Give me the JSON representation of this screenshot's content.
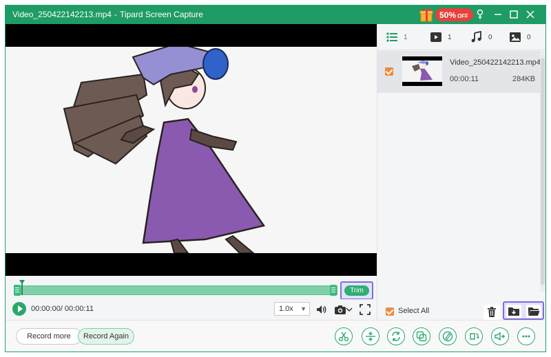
{
  "window": {
    "filename": "Video_250422142213.mp4",
    "separator": "-",
    "app_name": "Tipard Screen Capture"
  },
  "promo": {
    "percent": "50%",
    "off": "OFF"
  },
  "title_controls": [
    "pin-icon",
    "minimize-icon",
    "maximize-icon",
    "close-icon"
  ],
  "timeline": {
    "trim_label": "Trim"
  },
  "playback": {
    "time": "00:00:00/ 00:00:11",
    "speed": "1.0x"
  },
  "panel": {
    "tabs": [
      {
        "icon": "list-icon",
        "count": "1"
      },
      {
        "icon": "video-icon",
        "count": "1"
      },
      {
        "icon": "music-icon",
        "count": "0"
      },
      {
        "icon": "image-icon",
        "count": "0"
      }
    ],
    "files": [
      {
        "name": "Video_250422142213.mp4",
        "duration": "00:00:11",
        "size": "284KB",
        "checked": true
      }
    ],
    "select_all": "Select All"
  },
  "bottom": {
    "record_more": "Record more",
    "record_again": "Record Again",
    "tools": [
      "trim-tool-icon",
      "merge-tool-icon",
      "convert-tool-icon",
      "crop-tool-icon",
      "edit-tool-icon",
      "rotate-tool-icon",
      "volume-tool-icon",
      "more-icon"
    ]
  },
  "colors": {
    "brand": "#1f9b66",
    "accent_green": "#2aa86c",
    "highlight": "#7b6fd9",
    "checkbox": "#f08a3c",
    "promo_red": "#e8403a"
  }
}
